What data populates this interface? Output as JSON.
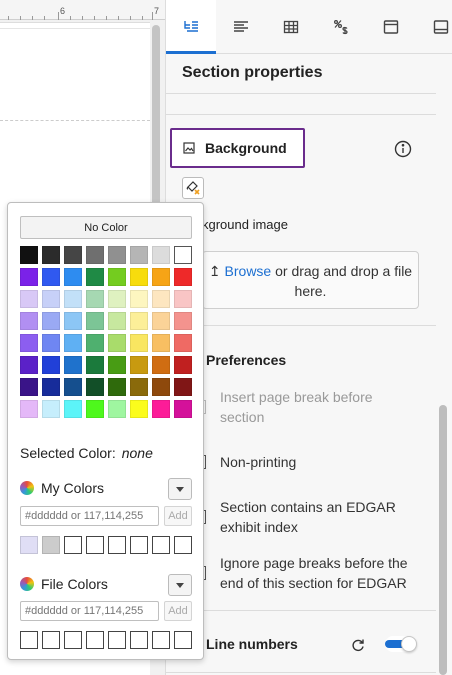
{
  "ruler": {
    "marks": [
      "6",
      "7"
    ]
  },
  "tabs": [
    {
      "icon": "outline-icon",
      "active": true
    },
    {
      "icon": "text-align-icon",
      "active": false
    },
    {
      "icon": "table-icon",
      "active": false
    },
    {
      "icon": "percent-dollar-icon",
      "active": false
    },
    {
      "icon": "window-icon",
      "active": false
    },
    {
      "icon": "panel-icon",
      "active": false
    }
  ],
  "panel": {
    "title": "Section properties",
    "background": {
      "label": "Background",
      "image_label": "kground image",
      "drop_link": "Browse",
      "drop_text": "or drag and drop a file here."
    },
    "preferences": {
      "title": "Preferences",
      "items": [
        {
          "label": "Insert page break before section",
          "disabled": true
        },
        {
          "label": "Non-printing",
          "disabled": false
        },
        {
          "label": "Section contains an EDGAR exhibit index",
          "disabled": false
        },
        {
          "label": "Ignore page breaks before the end of this section for EDGAR",
          "disabled": false
        }
      ]
    },
    "line_numbers": {
      "label": "Line numbers",
      "enabled": true
    }
  },
  "picker": {
    "no_color_label": "No Color",
    "selected_color_label": "Selected Color:",
    "selected_color_value": "none",
    "my_colors_label": "My Colors",
    "file_colors_label": "File Colors",
    "hex_placeholder": "#dddddd or 117,114,255",
    "add_label": "Add",
    "my_colors": [
      "#e0def5",
      "#cccccc"
    ],
    "palette": [
      [
        "#111111",
        "#2b2b2b",
        "#454545",
        "#6f6f6f",
        "#909090",
        "#b5b5b5",
        "#dcdcdc",
        "#ffffff"
      ],
      [
        "#7b22e8",
        "#3059f0",
        "#2e8cf0",
        "#1f8a45",
        "#74cc1f",
        "#f7dc0d",
        "#f6a416",
        "#ee2929"
      ],
      [
        "#d8c8f6",
        "#c7d0f8",
        "#c2e0f8",
        "#a6d8b2",
        "#dff1c0",
        "#fdf6c0",
        "#fde6c0",
        "#f9c5c5"
      ],
      [
        "#b18ff2",
        "#9aa9f4",
        "#8cc6f5",
        "#7cc596",
        "#c7e89f",
        "#fcef99",
        "#fbd398",
        "#f4938e"
      ],
      [
        "#8c5ef0",
        "#6f86f2",
        "#5fb0f3",
        "#4fb06f",
        "#a9dc6b",
        "#f9e661",
        "#f8bf62",
        "#ef6a64"
      ],
      [
        "#5b21c8",
        "#2140d8",
        "#1f72cc",
        "#1b7a3c",
        "#489c14",
        "#c89a10",
        "#d06d12",
        "#c02020"
      ],
      [
        "#3a1488",
        "#172c9a",
        "#154f8e",
        "#124f28",
        "#2f6a0c",
        "#8a6a0b",
        "#8e490c",
        "#801616"
      ],
      [
        "#e4b8f8",
        "#c6eefc",
        "#5cf4f8",
        "#4ef81c",
        "#9ff6a0",
        "#fbfc1c",
        "#fc1c98",
        "#d4119a"
      ]
    ],
    "file_color_slots": 8
  },
  "colors": {
    "accent": "#1c6fd1",
    "highlight_border": "#6a2c8c"
  }
}
